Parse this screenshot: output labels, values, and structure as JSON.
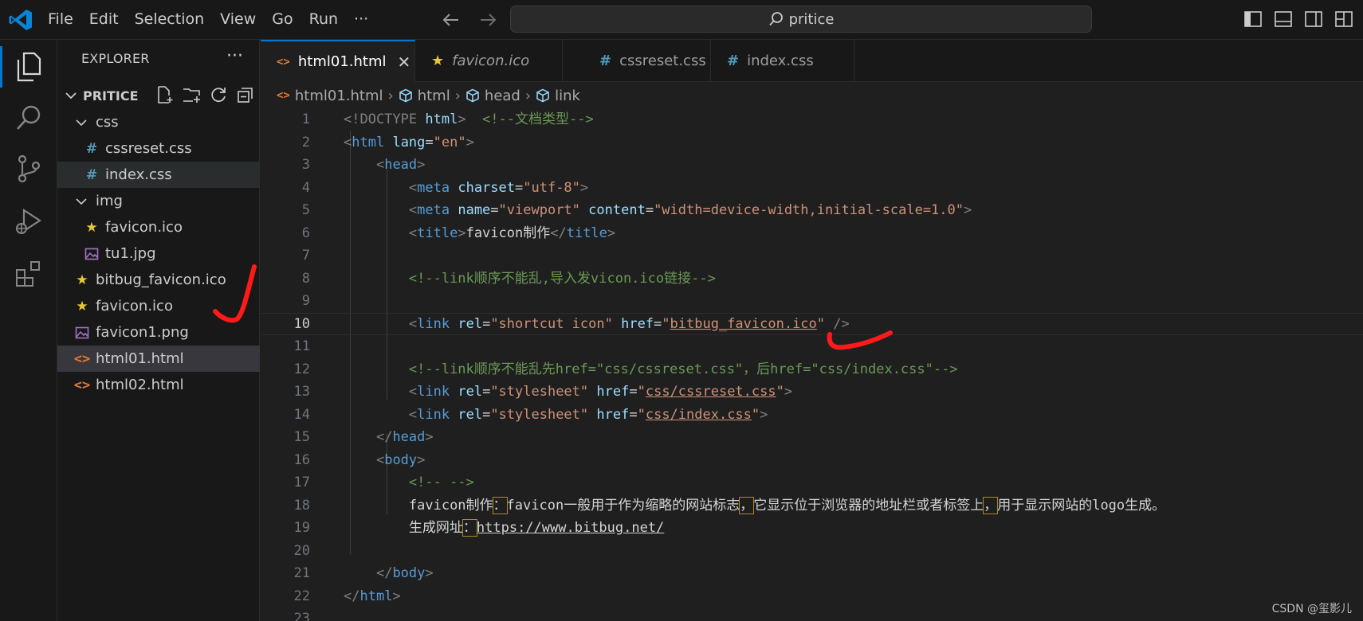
{
  "menu": [
    "File",
    "Edit",
    "Selection",
    "View",
    "Go",
    "Run",
    "···"
  ],
  "search": {
    "text": "pritice"
  },
  "sidebar": {
    "title": "EXPLORER",
    "more": "···",
    "root": "PRITICE",
    "items": [
      {
        "label": "css",
        "kind": "folder",
        "depth": 1
      },
      {
        "label": "cssreset.css",
        "kind": "css",
        "depth": 2
      },
      {
        "label": "index.css",
        "kind": "css",
        "depth": 2
      },
      {
        "label": "img",
        "kind": "folder",
        "depth": 1
      },
      {
        "label": "favicon.ico",
        "kind": "ico",
        "depth": 2
      },
      {
        "label": "tu1.jpg",
        "kind": "image",
        "depth": 2
      },
      {
        "label": "bitbug_favicon.ico",
        "kind": "ico",
        "depth": 1
      },
      {
        "label": "favicon.ico",
        "kind": "ico",
        "depth": 1
      },
      {
        "label": "favicon1.png",
        "kind": "image",
        "depth": 1
      },
      {
        "label": "html01.html",
        "kind": "html",
        "depth": 1
      },
      {
        "label": "html02.html",
        "kind": "html",
        "depth": 1
      }
    ]
  },
  "tabs": [
    {
      "label": "html01.html",
      "kind": "html"
    },
    {
      "label": "favicon.ico",
      "kind": "ico"
    },
    {
      "label": "cssreset.css",
      "kind": "css"
    },
    {
      "label": "index.css",
      "kind": "css"
    }
  ],
  "tab_close": "✕",
  "breadcrumb": [
    "html01.html",
    "html",
    "head",
    "link"
  ],
  "editor": {
    "current_line": 10,
    "line_numbers": [
      "1",
      "2",
      "3",
      "4",
      "5",
      "6",
      "7",
      "8",
      "9",
      "10",
      "11",
      "12",
      "13",
      "14",
      "15",
      "16",
      "17",
      "18",
      "19",
      "20",
      "21",
      "22",
      "23"
    ],
    "code": {
      "l1_doctype": "<!DOCTYPE ",
      "l1_html": "html",
      "l1_close": ">",
      "l1_comment": "<!--文档类型-->",
      "l2_open": "<",
      "l2_tag": "html",
      "l2_attr": "lang",
      "l2_eq": "=",
      "l2_val": "\"en\"",
      "l2_close": ">",
      "l3_tag": "head",
      "l4_tag": "meta",
      "l4_attr": "charset",
      "l4_val": "\"utf-8\"",
      "l5_tag": "meta",
      "l5_attr1": "name",
      "l5_val1": "\"viewport\"",
      "l5_attr2": "content",
      "l5_val2": "\"width=device-width,initial-scale=1.0\"",
      "l6_tag": "title",
      "l6_text": "favicon制作",
      "l6_endtag": "title",
      "l8_comment": "<!--link顺序不能乱,导入发vicon.ico链接-->",
      "l10_tag": "link",
      "l10_attr1": "rel",
      "l10_val1": "\"shortcut icon\"",
      "l10_attr2": "href",
      "l10_q": "\"",
      "l10_href": "bitbug_favicon.ico",
      "l10_end": " />",
      "l12_comment": "<!--link顺序不能乱先href=\"css/cssreset.css\"，后href=\"css/index.css\"-->",
      "l13_tag": "link",
      "l13_attr1": "rel",
      "l13_val1": "\"stylesheet\"",
      "l13_attr2": "href",
      "l13_href": "css/cssreset.css",
      "l14_tag": "link",
      "l14_attr1": "rel",
      "l14_val1": "\"stylesheet\"",
      "l14_attr2": "href",
      "l14_href": "css/index.css",
      "l15_tag": "head",
      "l16_tag": "body",
      "l17_comment": "<!-- -->",
      "l18_a": "favicon制作",
      "l18_b": "：",
      "l18_c": "favicon一般用于作为缩略的网站标志",
      "l18_d": "，",
      "l18_e": "它显示位于浏览器的地址栏或者标签上",
      "l18_f": "，",
      "l18_g": "用于显示网站的logo生成。",
      "l19_a": "生成网址",
      "l19_b": "：",
      "l19_c": "https://www.bitbug.net/",
      "l21_tag": "body",
      "l22_tag": "html"
    }
  },
  "watermark": "CSDN @玺影儿",
  "colors": {
    "accent": "#0078d4",
    "annotation": "#ff1a1a",
    "tag": "#569cd6",
    "string": "#ce9178",
    "comment": "#6a9955",
    "attr": "#9cdcfe"
  }
}
